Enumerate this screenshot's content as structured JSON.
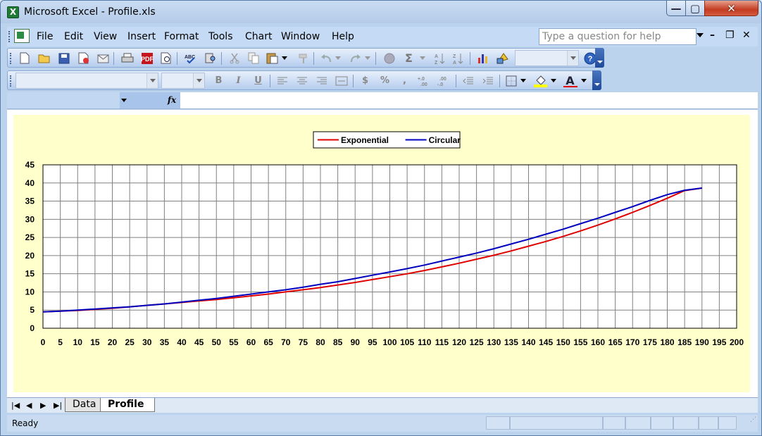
{
  "window": {
    "title": "Microsoft Excel - Profile.xls",
    "app_icon_letter": "X",
    "minimize_glyph": "—",
    "maximize_glyph": "▢",
    "close_glyph": "✕"
  },
  "menubar": {
    "items": [
      "File",
      "Edit",
      "View",
      "Insert",
      "Format",
      "Tools",
      "Chart",
      "Window",
      "Help"
    ],
    "help_placeholder": "Type a question for help",
    "mdi_minimize": "–",
    "mdi_restore": "❐",
    "mdi_close": "✕"
  },
  "toolbar": {
    "standard_icons": [
      "new-icon",
      "open-icon",
      "save-icon",
      "permission-icon",
      "email-icon",
      "print-icon",
      "pdf-icon",
      "print-preview-icon",
      "spelling-icon",
      "research-icon",
      "cut-icon",
      "copy-icon",
      "paste-icon",
      "format-painter-icon",
      "undo-icon",
      "redo-icon",
      "hyperlink-icon",
      "autosum-icon",
      "sort-asc-icon",
      "sort-desc-icon",
      "chart-wizard-icon",
      "drawing-icon",
      "zoom-box",
      "help-icon"
    ],
    "formatting_labels": {
      "bold": "B",
      "italic": "I",
      "underline": "U",
      "currency": "$",
      "percent": "%",
      "comma": ",",
      "font_color": "A"
    }
  },
  "formula_bar": {
    "fx_label": "fx"
  },
  "chart_data": {
    "type": "line",
    "x": [
      0,
      5,
      10,
      15,
      20,
      25,
      30,
      35,
      40,
      45,
      50,
      55,
      60,
      65,
      70,
      75,
      80,
      85,
      90,
      95,
      100,
      105,
      110,
      115,
      120,
      125,
      130,
      135,
      140,
      145,
      150,
      155,
      160,
      165,
      170,
      175,
      180,
      185,
      190
    ],
    "series": [
      {
        "name": "Exponential",
        "color": "#e00000",
        "values": [
          4.5,
          4.7,
          4.9,
          5.2,
          5.5,
          5.9,
          6.3,
          6.7,
          7.1,
          7.5,
          7.9,
          8.4,
          8.9,
          9.4,
          10.0,
          10.6,
          11.2,
          11.9,
          12.6,
          13.4,
          14.2,
          15.0,
          15.9,
          16.9,
          17.9,
          19.0,
          20.1,
          21.3,
          22.6,
          23.9,
          25.3,
          26.8,
          28.4,
          30.1,
          31.9,
          33.8,
          35.8,
          37.9,
          38.6
        ]
      },
      {
        "name": "Circular",
        "color": "#0000c0",
        "values": [
          4.5,
          4.7,
          5.0,
          5.3,
          5.6,
          5.9,
          6.3,
          6.7,
          7.2,
          7.7,
          8.2,
          8.8,
          9.4,
          10.0,
          10.6,
          11.3,
          12.1,
          12.8,
          13.7,
          14.6,
          15.5,
          16.4,
          17.4,
          18.5,
          19.6,
          20.7,
          21.9,
          23.2,
          24.5,
          25.9,
          27.3,
          28.8,
          30.3,
          31.9,
          33.5,
          35.2,
          36.8,
          38.0,
          38.6
        ]
      }
    ],
    "x_ticks": [
      "0",
      "5",
      "10",
      "15",
      "20",
      "25",
      "30",
      "35",
      "40",
      "45",
      "50",
      "55",
      "60",
      "65",
      "70",
      "75",
      "80",
      "85",
      "90",
      "95",
      "100",
      "105",
      "110",
      "115",
      "120",
      "125",
      "130",
      "135",
      "140",
      "145",
      "150",
      "155",
      "160",
      "165",
      "170",
      "175",
      "180",
      "185",
      "190",
      "195",
      "200"
    ],
    "y_ticks": [
      "0",
      "5",
      "10",
      "15",
      "20",
      "25",
      "30",
      "35",
      "40",
      "45"
    ],
    "xlim": [
      0,
      200
    ],
    "ylim": [
      0,
      45
    ],
    "grid": true,
    "legend_position": "top-center",
    "title": "",
    "xlabel": "",
    "ylabel": ""
  },
  "sheets": {
    "tabs": [
      "Data",
      "Profile"
    ],
    "active": "Profile",
    "nav": {
      "first": "|◀",
      "prev": "◀",
      "next": "▶",
      "last": "▶|"
    }
  },
  "status": {
    "text": "Ready"
  }
}
